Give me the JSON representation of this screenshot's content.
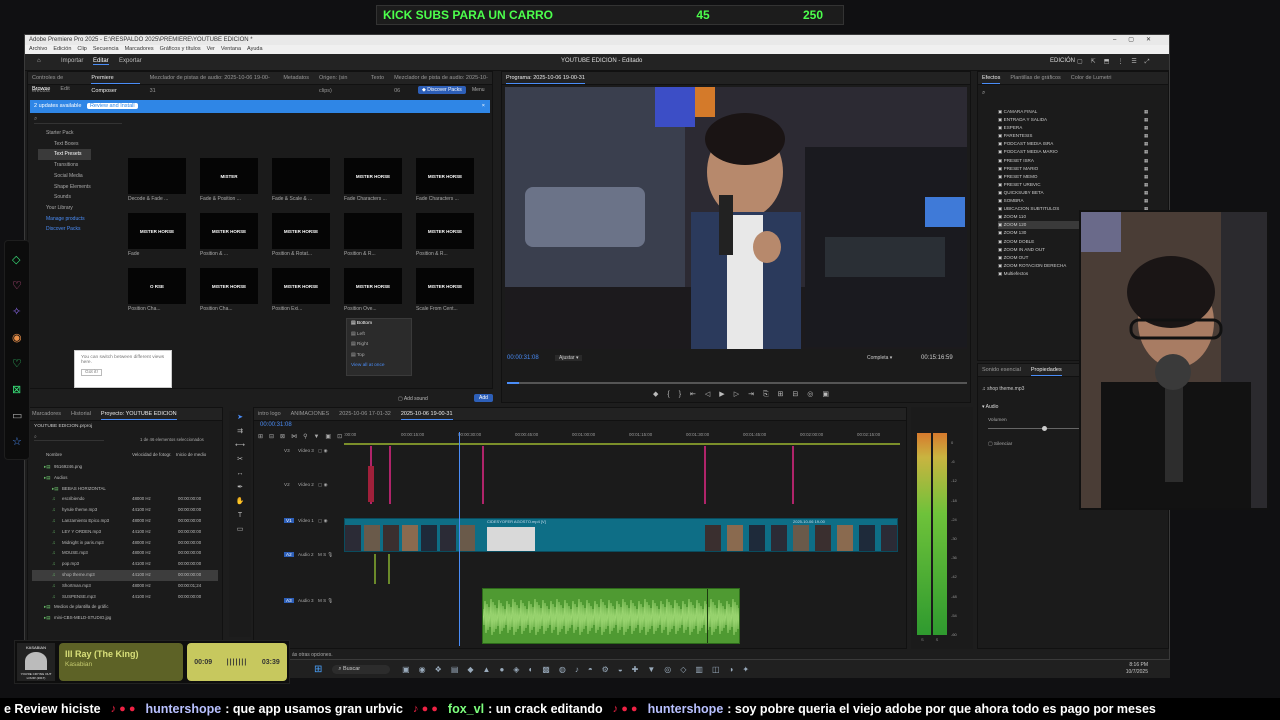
{
  "goal_bar": {
    "text": "KICK SUBS PARA UN CARRO",
    "current": "45",
    "target": "250"
  },
  "window": {
    "title": "Adobe Premiere Pro 2025 - E:\\RESPALDO 2025\\PREMIERE\\YOUTUBE EDICION *",
    "menu": [
      "Archivo",
      "Edición",
      "Clip",
      "Secuencia",
      "Marcadores",
      "Gráficos y títulos",
      "Ver",
      "Ventana",
      "Ayuda"
    ],
    "workspaces": [
      "Importar",
      "Editar",
      "Exportar"
    ],
    "project_title": "YOUTUBE EDICION - Editado",
    "right_label": "EDICIÓN"
  },
  "source_panel": {
    "tabs": [
      "Controles de efectos",
      "Premiere Composer",
      "Mezclador de pistas de audio: 2025-10-06 19-00-31",
      "Metadatos",
      "Origen: (sin clips)",
      "Texto",
      "Mezclador de pista de audio: 2025-10-06"
    ],
    "subtabs": [
      "Browse",
      "Edit"
    ],
    "discover": "Discover Packs",
    "menu": "Menu",
    "update_banner": "2 updates available",
    "update_button": "Review and Install",
    "tree": [
      "Starter Pack",
      "Text Boxes",
      "Text Presets",
      "Transitions",
      "Social Media",
      "Shape Elements",
      "Sounds",
      "Your Library",
      "Manage products",
      "Discover Packs"
    ],
    "thumbs": [
      {
        "preview": "",
        "label": "Decode & Fade ..."
      },
      {
        "preview": "MISTER",
        "label": "Fade & Position ..."
      },
      {
        "preview": "",
        "label": "Fade & Scale & ..."
      },
      {
        "preview": "MISTER HORSE",
        "label": "Fade Characters ..."
      },
      {
        "preview": "MISTER HORSE",
        "label": "Fade Characters ..."
      },
      {
        "preview": "MISTER HORSE",
        "label": "Fade"
      },
      {
        "preview": "MISTER HORSE",
        "label": "Position & ..."
      },
      {
        "preview": "MISTER HORSE",
        "label": "Position & Rotat..."
      },
      {
        "preview": "",
        "label": "Position & R..."
      },
      {
        "preview": "MISTER HORSE",
        "label": "Position & R..."
      },
      {
        "preview": "O RSE",
        "label": "Position Cha..."
      },
      {
        "preview": "MISTER HORSE",
        "label": "Position Cha..."
      },
      {
        "preview": "MISTER HORSE",
        "label": "Position Exi..."
      },
      {
        "preview": "MISTER HORSE",
        "label": "Position Ove..."
      },
      {
        "preview": "MISTER HORSE",
        "label": "Scale From Cent..."
      }
    ],
    "dropdown_options": [
      "Bottom",
      "Left",
      "Right",
      "Top"
    ],
    "dropdown_link": "View all at once",
    "tooltip": "You can switch between different views here.",
    "tooltip_button": "Got it!",
    "footer_add_sound": "Add sound",
    "footer_add": "Add"
  },
  "program_monitor": {
    "tab": "Programa: 2025-10-06 19-00-31",
    "timecode": "00:00:31:08",
    "fit": "Ajustar",
    "quality": "Completa",
    "duration": "00:15:16:59"
  },
  "effects_panel": {
    "tabs": [
      "Efectos",
      "Plantillas de gráficos",
      "Color de Lumetri"
    ],
    "items": [
      "CAMARA FINAL",
      "ENTRADA Y SALIDA",
      "ESPERA",
      "PARENTESIS",
      "PODCAST MEDIA ISRA",
      "PODCAST MEDIA MARIO",
      "PRESET ISRA",
      "PRESET MARIO",
      "PRESET MEMO",
      "PRESET URBVIC",
      "QUICKSUBY BETA",
      "SOMBRA",
      "UBICACION SUBTITULOS",
      "ZOOM 110",
      "ZOOM 120",
      "ZOOM 130",
      "ZOOM DOBLE",
      "ZOOM IN AND OUT",
      "ZOOM OUT",
      "ZOOM ROTACION DERECHA",
      "Multiefectos"
    ]
  },
  "properties_panel": {
    "tabs": [
      "Sonido esencial",
      "Propiedades"
    ],
    "file": "shop theme.mp3",
    "section": "Audio",
    "volume_label": "Volumen",
    "mute_label": "Silenciar"
  },
  "project_panel": {
    "tabs": [
      "Marcadores",
      "Historial",
      "Proyecto: YOUTUBE EDICION"
    ],
    "project_file": "YOUTUBE EDICION.prproj",
    "selection": "1 de 46 elementos seleccionados",
    "columns": [
      "Nombre",
      "Velocidad de fotogr.",
      "Inicio de medio"
    ],
    "rows": [
      {
        "name": "95169246.png",
        "rate": "",
        "start": ""
      },
      {
        "name": "Audios",
        "rate": "",
        "start": ""
      },
      {
        "name": "BEBAS HORIZONTAL",
        "rate": "",
        "start": ""
      },
      {
        "name": "escribiendo",
        "rate": "48000 Hz",
        "start": "00:00:00:00"
      },
      {
        "name": "hyrule theme.mp3",
        "rate": "44100 Hz",
        "start": "00:00:00:00"
      },
      {
        "name": "Lanzamiento Epico.mp3",
        "rate": "48000 Hz",
        "start": "00:00:00:00"
      },
      {
        "name": "LEY Y ORDEN.mp3",
        "rate": "44100 Hz",
        "start": "00:00:00:00"
      },
      {
        "name": "Midnight in paris.mp3",
        "rate": "48000 Hz",
        "start": "00:00:00:00"
      },
      {
        "name": "MOUSE.mp3",
        "rate": "48000 Hz",
        "start": "00:00:00:00"
      },
      {
        "name": "pop.mp3",
        "rate": "44100 Hz",
        "start": "00:00:00:00"
      },
      {
        "name": "shop theme.mp3",
        "rate": "44100 Hz",
        "start": "00:00:00:00"
      },
      {
        "name": "Shortman.mp3",
        "rate": "48000 Hz",
        "start": "00:00:01;24"
      },
      {
        "name": "SUSPENSE.mp3",
        "rate": "44100 Hz",
        "start": "00:00:00:00"
      },
      {
        "name": "Medios de plantilla de gráfic",
        "rate": "",
        "start": ""
      },
      {
        "name": "mini-CBS-MELD-STUDIO.jpg",
        "rate": "",
        "start": ""
      }
    ]
  },
  "timeline": {
    "tabs": [
      "intro logo",
      "ANIMACIONES",
      "2025-10-06 17-01-32",
      "2025-10-06 19-00-31"
    ],
    "timecode": "00:00:31:08",
    "ruler": [
      ":00:00",
      "00:00:15:00",
      "00:00:30:00",
      "00:00:45:00",
      "00:01:00:00",
      "00:01:15:00",
      "00:01:30:00",
      "00:01:45:00",
      "00:02:00:00",
      "00:02:15:00"
    ],
    "tracks": [
      "Vídeo 3",
      "Vídeo 2",
      "Vídeo 1",
      "Audio 2",
      "Audio 3"
    ],
    "track_ids": [
      "V3",
      "V2",
      "V1",
      "A2",
      "A3"
    ],
    "clip_label": "CIDESYOFER AGOSTO.mp4 [V]",
    "clip_label_2": "2025-10-06 19-00",
    "meter_scale": [
      "0",
      "-6",
      "-12",
      "-18",
      "-24",
      "-30",
      "-36",
      "-42",
      "-48",
      "-54",
      "-60"
    ],
    "meter_bottom": [
      "S",
      "S"
    ]
  },
  "taskbar": {
    "search": "Buscar",
    "time": "8:16 PM",
    "date": "10/7/2025",
    "tooltip": "ás otras opciones."
  },
  "music": {
    "title": "Ill Ray (The King)",
    "artist": "Kasabian",
    "current": "00:09",
    "total": "03:39",
    "cover_top": "KASABIAN",
    "cover_bottom": "YOU'RE CRYING OUT LOUD! (2017)"
  },
  "chat": [
    {
      "user": "",
      "msg": "e Review hiciste"
    },
    {
      "user": "huntershope",
      "msg": ": que app usamos gran urbvic"
    },
    {
      "user": "fox_vl",
      "msg": ": un crack editando"
    },
    {
      "user": "huntershope",
      "msg": ": soy pobre queria el viejo adobe por que ahora todo es pago por meses"
    }
  ],
  "colors": {
    "accent": "#4a8df8",
    "audio_clip": "#4f9a32",
    "video_clip": "#0e6e86",
    "goal_green": "#4cff4c",
    "banner": "#2f86e6"
  }
}
